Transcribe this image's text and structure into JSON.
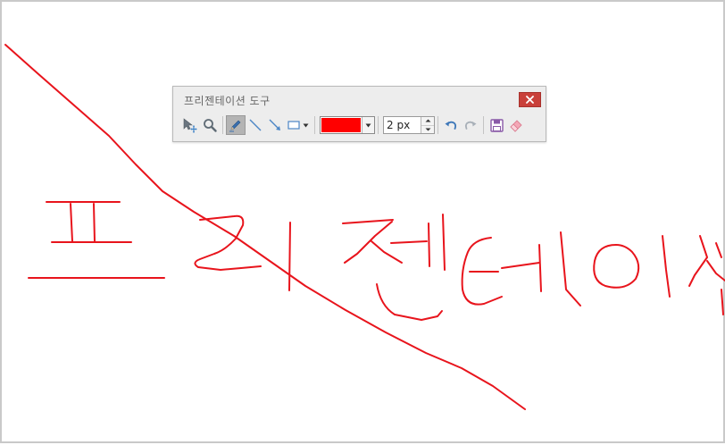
{
  "toolbar": {
    "title": "프리젠테이션 도구",
    "close_label": "✕",
    "tools": [
      {
        "name": "select-move",
        "icon": "cursor-move-icon"
      },
      {
        "name": "zoom",
        "icon": "magnifier-icon"
      },
      {
        "name": "pen",
        "icon": "pen-icon",
        "active": true
      },
      {
        "name": "line",
        "icon": "line-icon"
      },
      {
        "name": "arrow",
        "icon": "arrow-icon"
      },
      {
        "name": "rectangle",
        "icon": "rectangle-icon"
      }
    ],
    "color": {
      "value": "#ff0000"
    },
    "pen_size": {
      "value": "2 px"
    },
    "actions": [
      "undo-icon",
      "redo-icon",
      "save-icon",
      "eraser-icon"
    ]
  },
  "ink": {
    "color": "#e8141c"
  }
}
